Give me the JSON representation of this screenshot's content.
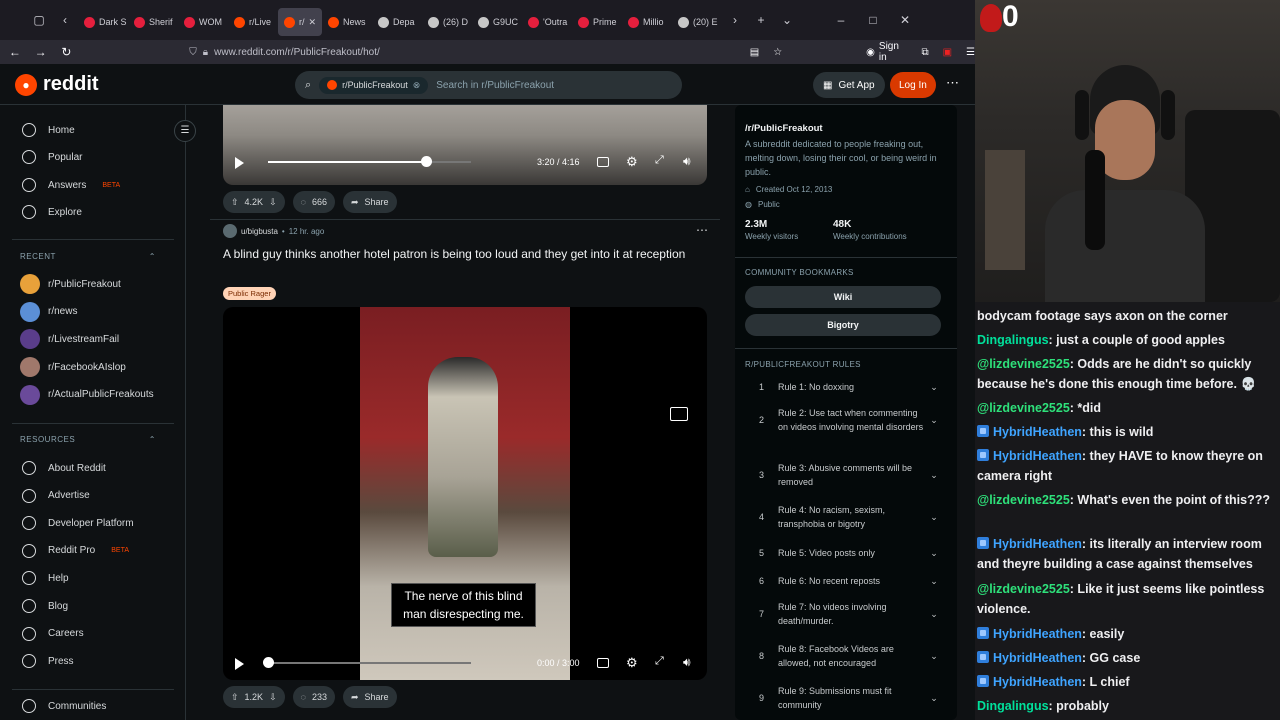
{
  "browser": {
    "tabs": [
      {
        "label": "Dark S",
        "color": "#e51f3d"
      },
      {
        "label": "Sherif",
        "color": "#e51f3d"
      },
      {
        "label": "WOM",
        "color": "#e51f3d"
      },
      {
        "label": "r/Live",
        "color": "#ff4500"
      },
      {
        "label": "r/",
        "color": "#ff4500",
        "active": true
      },
      {
        "label": "News",
        "color": "#ff4500"
      },
      {
        "label": "Depa",
        "color": "#c7c7c7"
      },
      {
        "label": "(26) D",
        "color": "#c7c7c7"
      },
      {
        "label": "G9UC",
        "color": "#c7c7c7"
      },
      {
        "label": "'Outra",
        "color": "#e51f3d"
      },
      {
        "label": "Prime",
        "color": "#e51f3d"
      },
      {
        "label": "Millio",
        "color": "#e51f3d"
      },
      {
        "label": "(20) E",
        "color": "#c7c7c7"
      }
    ],
    "url": "www.reddit.com/r/PublicFreakout/hot/",
    "sign_in": "Sign in"
  },
  "header": {
    "logo_text": "reddit",
    "search_chip": "r/PublicFreakout",
    "search_placeholder": "Search in r/PublicFreakout",
    "get_app": "Get App",
    "login": "Log In"
  },
  "sidebar": {
    "nav": [
      {
        "label": "Home",
        "icon": "home-icon"
      },
      {
        "label": "Popular",
        "icon": "popular-icon"
      },
      {
        "label": "Answers",
        "icon": "answers-icon",
        "badge": "BETA"
      },
      {
        "label": "Explore",
        "icon": "explore-icon"
      }
    ],
    "recent_heading": "RECENT",
    "recent": [
      {
        "label": "r/PublicFreakout",
        "color": "#e8a13a"
      },
      {
        "label": "r/news",
        "color": "#5b8fd6"
      },
      {
        "label": "r/LivestreamFail",
        "color": "#5a3d8a"
      },
      {
        "label": "r/FacebookAIslop",
        "color": "#a0786b"
      },
      {
        "label": "r/ActualPublicFreakouts",
        "color": "#6a4a9a"
      }
    ],
    "resources_heading": "RESOURCES",
    "resources": [
      {
        "label": "About Reddit"
      },
      {
        "label": "Advertise"
      },
      {
        "label": "Developer Platform"
      },
      {
        "label": "Reddit Pro",
        "badge": "BETA"
      },
      {
        "label": "Help"
      },
      {
        "label": "Blog"
      },
      {
        "label": "Careers"
      },
      {
        "label": "Press"
      }
    ],
    "communities": "Communities"
  },
  "feed": {
    "post1": {
      "time": "3:20 / 4:16",
      "progress": 0.78,
      "upvotes": "4.2K",
      "comments": "666",
      "share": "Share"
    },
    "post2": {
      "author": "u/bigbusta",
      "age": "12 hr. ago",
      "title": "A blind guy thinks another hotel patron is being too loud and they get into it at reception",
      "flair": "Public Rager",
      "caption": "The nerve of this blind man disrespecting me.",
      "time": "0:00 / 3:00",
      "progress": 0.0,
      "upvotes": "1.2K",
      "comments": "233",
      "share": "Share"
    }
  },
  "community": {
    "name": "/r/PublicFreakout",
    "description": "A subreddit dedicated to people freaking out, melting down, losing their cool, or being weird in public.",
    "created": "Created Oct 12, 2013",
    "visibility": "Public",
    "visitors": "2.3M",
    "visitors_label": "Weekly visitors",
    "contributions": "48K",
    "contributions_label": "Weekly contributions",
    "bookmarks_heading": "COMMUNITY BOOKMARKS",
    "bookmarks": [
      "Wiki",
      "Bigotry"
    ],
    "rules_heading": "R/PUBLICFREAKOUT RULES",
    "rules": [
      {
        "n": "1",
        "text": "Rule 1: No doxxing"
      },
      {
        "n": "2",
        "text": "Rule 2: Use tact when commenting on videos involving mental disorders"
      },
      {
        "n": "3",
        "text": "Rule 3: Abusive comments will be removed"
      },
      {
        "n": "4",
        "text": "Rule 4: No racism, sexism, transphobia or bigotry"
      },
      {
        "n": "5",
        "text": "Rule 5: Video posts only"
      },
      {
        "n": "6",
        "text": "Rule 6: No recent reposts"
      },
      {
        "n": "7",
        "text": "Rule 7: No videos involving death/murder."
      },
      {
        "n": "8",
        "text": "Rule 8: Facebook Videos are allowed, not encouraged"
      },
      {
        "n": "9",
        "text": "Rule 9: Submissions must fit community"
      }
    ]
  },
  "stream": {
    "counter": "0",
    "chat": [
      {
        "user": "",
        "text": "bodycam footage says axon on the corner",
        "color": "#efeff1",
        "badge": false
      },
      {
        "user": "Dingalingus",
        "text": ": just a couple of good apples",
        "color": "#00e09b",
        "badge": false
      },
      {
        "user": "@lizdevine2525",
        "text": ": Odds are he didn't so quickly because he's done this enough time before. 💀",
        "color": "#2ee07a",
        "badge": false
      },
      {
        "user": "@lizdevine2525",
        "text": ": *did",
        "color": "#2ee07a",
        "badge": false
      },
      {
        "user": "HybridHeathen",
        "text": ": this is wild",
        "color": "#3fa4ff",
        "badge": true
      },
      {
        "user": "HybridHeathen",
        "text": ": they HAVE to know theyre on camera right",
        "color": "#3fa4ff",
        "badge": true
      },
      {
        "user": "@lizdevine2525",
        "text": ": What's even the point of this???",
        "color": "#2ee07a",
        "badge": false
      },
      {
        "user": "HybridHeathen",
        "text": ": its literally an interview room and theyre building a case against themselves",
        "color": "#3fa4ff",
        "badge": true
      },
      {
        "user": "@lizdevine2525",
        "text": ": Like it just seems like pointless violence.",
        "color": "#2ee07a",
        "badge": false
      },
      {
        "user": "HybridHeathen",
        "text": ": easily",
        "color": "#3fa4ff",
        "badge": true
      },
      {
        "user": "HybridHeathen",
        "text": ": GG case",
        "color": "#3fa4ff",
        "badge": true
      },
      {
        "user": "HybridHeathen",
        "text": ": L chief",
        "color": "#3fa4ff",
        "badge": true
      },
      {
        "user": "Dingalingus",
        "text": ": probably",
        "color": "#00e09b",
        "badge": false
      }
    ]
  }
}
